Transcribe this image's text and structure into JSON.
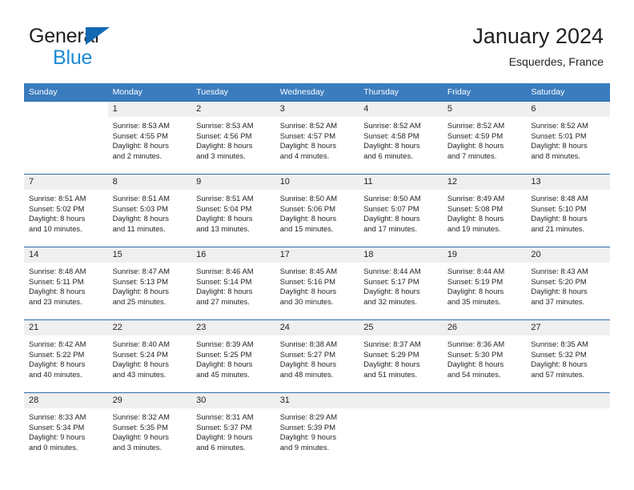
{
  "brand": {
    "name_part1": "General",
    "name_part2": "Blue",
    "triangle_icon": "blue-triangle-icon",
    "accent_color": "#1c8ad4",
    "triangle_color": "#1268b3"
  },
  "header": {
    "title": "January 2024",
    "subtitle": "Esquerdes, France"
  },
  "theme": {
    "header_row_bg": "#3a7cbe",
    "daynum_bg": "#efefef",
    "row_rule": "#2f6ca8"
  },
  "calendar": {
    "weekday_headers": [
      "Sunday",
      "Monday",
      "Tuesday",
      "Wednesday",
      "Thursday",
      "Friday",
      "Saturday"
    ],
    "weeks": [
      [
        {
          "day": "",
          "blank": true,
          "lines": []
        },
        {
          "day": "1",
          "lines": [
            "Sunrise: 8:53 AM",
            "Sunset: 4:55 PM",
            "Daylight: 8 hours",
            "and 2 minutes."
          ]
        },
        {
          "day": "2",
          "lines": [
            "Sunrise: 8:53 AM",
            "Sunset: 4:56 PM",
            "Daylight: 8 hours",
            "and 3 minutes."
          ]
        },
        {
          "day": "3",
          "lines": [
            "Sunrise: 8:52 AM",
            "Sunset: 4:57 PM",
            "Daylight: 8 hours",
            "and 4 minutes."
          ]
        },
        {
          "day": "4",
          "lines": [
            "Sunrise: 8:52 AM",
            "Sunset: 4:58 PM",
            "Daylight: 8 hours",
            "and 6 minutes."
          ]
        },
        {
          "day": "5",
          "lines": [
            "Sunrise: 8:52 AM",
            "Sunset: 4:59 PM",
            "Daylight: 8 hours",
            "and 7 minutes."
          ]
        },
        {
          "day": "6",
          "lines": [
            "Sunrise: 8:52 AM",
            "Sunset: 5:01 PM",
            "Daylight: 8 hours",
            "and 8 minutes."
          ]
        }
      ],
      [
        {
          "day": "7",
          "lines": [
            "Sunrise: 8:51 AM",
            "Sunset: 5:02 PM",
            "Daylight: 8 hours",
            "and 10 minutes."
          ]
        },
        {
          "day": "8",
          "lines": [
            "Sunrise: 8:51 AM",
            "Sunset: 5:03 PM",
            "Daylight: 8 hours",
            "and 11 minutes."
          ]
        },
        {
          "day": "9",
          "lines": [
            "Sunrise: 8:51 AM",
            "Sunset: 5:04 PM",
            "Daylight: 8 hours",
            "and 13 minutes."
          ]
        },
        {
          "day": "10",
          "lines": [
            "Sunrise: 8:50 AM",
            "Sunset: 5:06 PM",
            "Daylight: 8 hours",
            "and 15 minutes."
          ]
        },
        {
          "day": "11",
          "lines": [
            "Sunrise: 8:50 AM",
            "Sunset: 5:07 PM",
            "Daylight: 8 hours",
            "and 17 minutes."
          ]
        },
        {
          "day": "12",
          "lines": [
            "Sunrise: 8:49 AM",
            "Sunset: 5:08 PM",
            "Daylight: 8 hours",
            "and 19 minutes."
          ]
        },
        {
          "day": "13",
          "lines": [
            "Sunrise: 8:48 AM",
            "Sunset: 5:10 PM",
            "Daylight: 8 hours",
            "and 21 minutes."
          ]
        }
      ],
      [
        {
          "day": "14",
          "lines": [
            "Sunrise: 8:48 AM",
            "Sunset: 5:11 PM",
            "Daylight: 8 hours",
            "and 23 minutes."
          ]
        },
        {
          "day": "15",
          "lines": [
            "Sunrise: 8:47 AM",
            "Sunset: 5:13 PM",
            "Daylight: 8 hours",
            "and 25 minutes."
          ]
        },
        {
          "day": "16",
          "lines": [
            "Sunrise: 8:46 AM",
            "Sunset: 5:14 PM",
            "Daylight: 8 hours",
            "and 27 minutes."
          ]
        },
        {
          "day": "17",
          "lines": [
            "Sunrise: 8:45 AM",
            "Sunset: 5:16 PM",
            "Daylight: 8 hours",
            "and 30 minutes."
          ]
        },
        {
          "day": "18",
          "lines": [
            "Sunrise: 8:44 AM",
            "Sunset: 5:17 PM",
            "Daylight: 8 hours",
            "and 32 minutes."
          ]
        },
        {
          "day": "19",
          "lines": [
            "Sunrise: 8:44 AM",
            "Sunset: 5:19 PM",
            "Daylight: 8 hours",
            "and 35 minutes."
          ]
        },
        {
          "day": "20",
          "lines": [
            "Sunrise: 8:43 AM",
            "Sunset: 5:20 PM",
            "Daylight: 8 hours",
            "and 37 minutes."
          ]
        }
      ],
      [
        {
          "day": "21",
          "lines": [
            "Sunrise: 8:42 AM",
            "Sunset: 5:22 PM",
            "Daylight: 8 hours",
            "and 40 minutes."
          ]
        },
        {
          "day": "22",
          "lines": [
            "Sunrise: 8:40 AM",
            "Sunset: 5:24 PM",
            "Daylight: 8 hours",
            "and 43 minutes."
          ]
        },
        {
          "day": "23",
          "lines": [
            "Sunrise: 8:39 AM",
            "Sunset: 5:25 PM",
            "Daylight: 8 hours",
            "and 45 minutes."
          ]
        },
        {
          "day": "24",
          "lines": [
            "Sunrise: 8:38 AM",
            "Sunset: 5:27 PM",
            "Daylight: 8 hours",
            "and 48 minutes."
          ]
        },
        {
          "day": "25",
          "lines": [
            "Sunrise: 8:37 AM",
            "Sunset: 5:29 PM",
            "Daylight: 8 hours",
            "and 51 minutes."
          ]
        },
        {
          "day": "26",
          "lines": [
            "Sunrise: 8:36 AM",
            "Sunset: 5:30 PM",
            "Daylight: 8 hours",
            "and 54 minutes."
          ]
        },
        {
          "day": "27",
          "lines": [
            "Sunrise: 8:35 AM",
            "Sunset: 5:32 PM",
            "Daylight: 8 hours",
            "and 57 minutes."
          ]
        }
      ],
      [
        {
          "day": "28",
          "lines": [
            "Sunrise: 8:33 AM",
            "Sunset: 5:34 PM",
            "Daylight: 9 hours",
            "and 0 minutes."
          ]
        },
        {
          "day": "29",
          "lines": [
            "Sunrise: 8:32 AM",
            "Sunset: 5:35 PM",
            "Daylight: 9 hours",
            "and 3 minutes."
          ]
        },
        {
          "day": "30",
          "lines": [
            "Sunrise: 8:31 AM",
            "Sunset: 5:37 PM",
            "Daylight: 9 hours",
            "and 6 minutes."
          ]
        },
        {
          "day": "31",
          "lines": [
            "Sunrise: 8:29 AM",
            "Sunset: 5:39 PM",
            "Daylight: 9 hours",
            "and 9 minutes."
          ]
        },
        {
          "day": "",
          "empty": true,
          "lines": []
        },
        {
          "day": "",
          "empty": true,
          "lines": []
        },
        {
          "day": "",
          "empty": true,
          "lines": []
        }
      ]
    ]
  }
}
